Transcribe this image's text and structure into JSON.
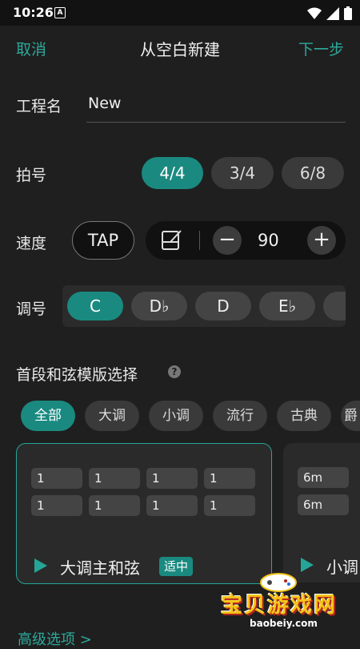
{
  "status_bar": {
    "time": "10:26",
    "notification_glyph": "A"
  },
  "nav": {
    "cancel": "取消",
    "title": "从空白新建",
    "next": "下一步"
  },
  "project_name": {
    "label": "工程名",
    "value": "New"
  },
  "time_signature": {
    "label": "拍号",
    "options": [
      {
        "label": "4/4",
        "selected": true
      },
      {
        "label": "3/4",
        "selected": false
      },
      {
        "label": "6/8",
        "selected": false
      }
    ]
  },
  "tempo": {
    "label": "速度",
    "tap": "TAP",
    "minus": "−",
    "value": "90",
    "plus": "+"
  },
  "key": {
    "label": "调号",
    "options": [
      {
        "label": "C",
        "selected": true
      },
      {
        "label": "D♭",
        "selected": false
      },
      {
        "label": "D",
        "selected": false
      },
      {
        "label": "E♭",
        "selected": false
      },
      {
        "label": "",
        "selected": false
      }
    ]
  },
  "template_section": {
    "title": "首段和弦模版选择",
    "help": "?",
    "filters": [
      {
        "label": "全部",
        "selected": true
      },
      {
        "label": "大调",
        "selected": false
      },
      {
        "label": "小调",
        "selected": false
      },
      {
        "label": "流行",
        "selected": false
      },
      {
        "label": "古典",
        "selected": false
      },
      {
        "label": "爵",
        "selected": false
      }
    ],
    "cards": [
      {
        "name": "大调主和弦",
        "badge": "适中",
        "selected": true,
        "chords": [
          [
            "1",
            "1",
            "1",
            "1"
          ],
          [
            "1",
            "1",
            "1",
            "1"
          ]
        ]
      },
      {
        "name": "小调",
        "badge": "",
        "selected": false,
        "chords": [
          [
            "6m"
          ],
          [
            "6m"
          ]
        ]
      }
    ]
  },
  "advanced": {
    "label": "高级选项 >"
  },
  "watermark": {
    "text": "宝贝游戏网",
    "url": "baobeiy.com"
  },
  "colors": {
    "accent": "#1a8a80",
    "accent_text": "#2ea89a",
    "background": "#1f1f1f"
  }
}
